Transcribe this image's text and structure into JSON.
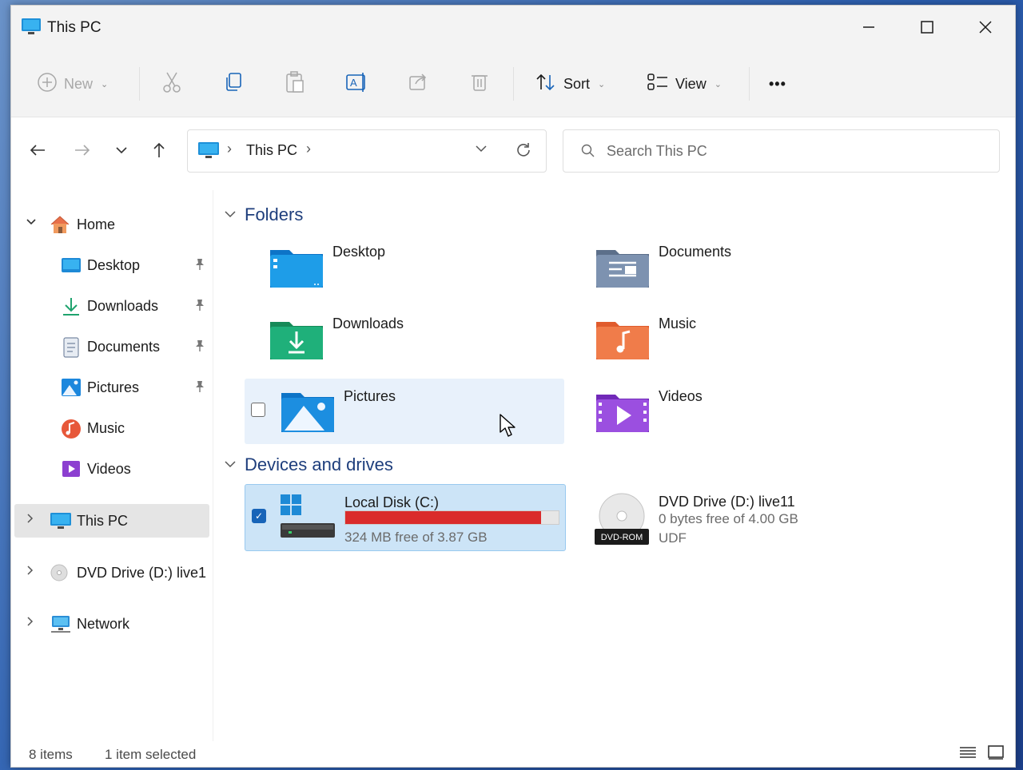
{
  "window": {
    "title": "This PC",
    "title_icon": "this-pc-icon",
    "controls": [
      "minimize",
      "maximize",
      "close"
    ]
  },
  "toolbar": {
    "new_label": "New",
    "sort_label": "Sort",
    "view_label": "View",
    "more_label": "•••"
  },
  "address": {
    "path": "This PC",
    "separator": "›",
    "separator_end": "›"
  },
  "search": {
    "placeholder": "Search This PC",
    "value": ""
  },
  "sidebar": {
    "items": [
      {
        "label": "Home",
        "icon": "home-icon"
      },
      {
        "label": "Desktop",
        "icon": "desktop-folder-icon",
        "pinned": true
      },
      {
        "label": "Downloads",
        "icon": "downloads-icon",
        "pinned": true
      },
      {
        "label": "Documents",
        "icon": "documents-icon",
        "pinned": true
      },
      {
        "label": "Pictures",
        "icon": "pictures-icon",
        "pinned": true
      },
      {
        "label": "Music",
        "icon": "music-icon"
      },
      {
        "label": "Videos",
        "icon": "videos-icon"
      },
      {
        "label": "This PC",
        "icon": "this-pc-icon",
        "selected": true
      },
      {
        "label": "DVD Drive (D:) live1",
        "icon": "dvd-icon"
      },
      {
        "label": "Network",
        "icon": "network-icon"
      }
    ],
    "pin_glyph": "📌"
  },
  "content": {
    "folders_header": "Folders",
    "folders": [
      {
        "label": "Desktop",
        "icon": "desktop-folder-icon"
      },
      {
        "label": "Documents",
        "icon": "documents-folder-icon"
      },
      {
        "label": "Downloads",
        "icon": "downloads-folder-icon"
      },
      {
        "label": "Music",
        "icon": "music-folder-icon"
      },
      {
        "label": "Pictures",
        "icon": "pictures-folder-icon"
      },
      {
        "label": "Videos",
        "icon": "videos-folder-icon"
      }
    ],
    "drives_header": "Devices and drives",
    "drives": [
      {
        "label": "Local Disk (C:)",
        "free_text": "324 MB free of 3.87 GB",
        "used_fraction": 0.918,
        "selected": true,
        "icon": "windows-drive-icon"
      },
      {
        "label": "DVD Drive (D:) live11",
        "line2": "0 bytes free of 4.00 GB",
        "line3": "UDF",
        "icon": "dvd-rom-icon",
        "badge": "DVD-ROM"
      }
    ]
  },
  "status": {
    "items": "8 items",
    "selection": "1 item selected"
  },
  "colors": {
    "accent": "#1864b8",
    "drive_full": "#da2b2b",
    "selection_bg": "#cce4f7",
    "section_header": "#1e3e7c"
  }
}
